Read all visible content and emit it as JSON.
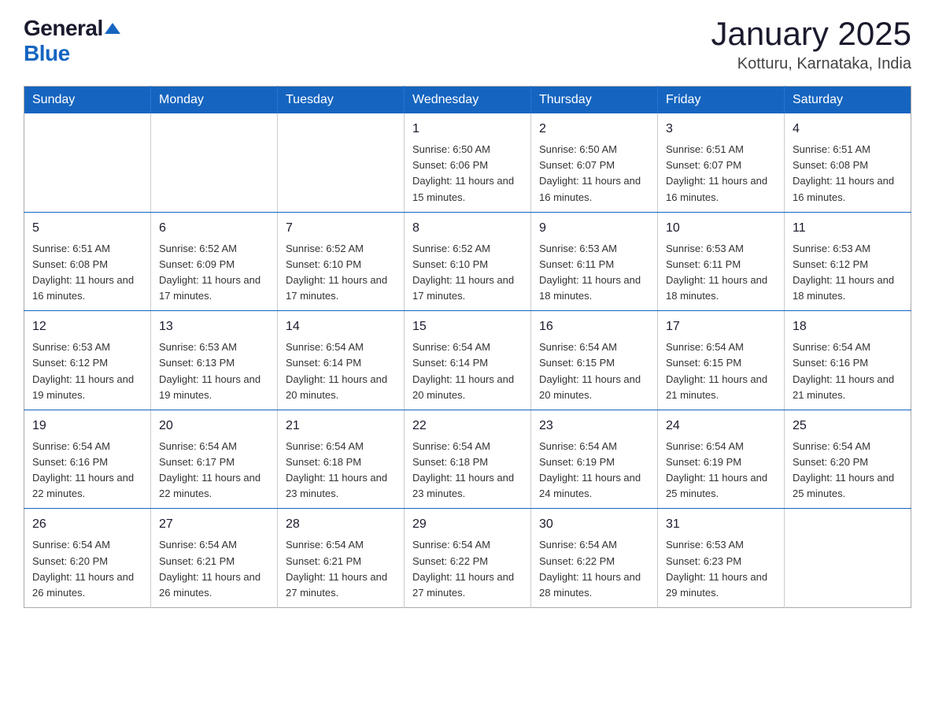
{
  "logo": {
    "general": "General",
    "blue": "Blue"
  },
  "title": "January 2025",
  "location": "Kotturu, Karnataka, India",
  "headers": [
    "Sunday",
    "Monday",
    "Tuesday",
    "Wednesday",
    "Thursday",
    "Friday",
    "Saturday"
  ],
  "weeks": [
    [
      {
        "day": "",
        "info": ""
      },
      {
        "day": "",
        "info": ""
      },
      {
        "day": "",
        "info": ""
      },
      {
        "day": "1",
        "info": "Sunrise: 6:50 AM\nSunset: 6:06 PM\nDaylight: 11 hours and 15 minutes."
      },
      {
        "day": "2",
        "info": "Sunrise: 6:50 AM\nSunset: 6:07 PM\nDaylight: 11 hours and 16 minutes."
      },
      {
        "day": "3",
        "info": "Sunrise: 6:51 AM\nSunset: 6:07 PM\nDaylight: 11 hours and 16 minutes."
      },
      {
        "day": "4",
        "info": "Sunrise: 6:51 AM\nSunset: 6:08 PM\nDaylight: 11 hours and 16 minutes."
      }
    ],
    [
      {
        "day": "5",
        "info": "Sunrise: 6:51 AM\nSunset: 6:08 PM\nDaylight: 11 hours and 16 minutes."
      },
      {
        "day": "6",
        "info": "Sunrise: 6:52 AM\nSunset: 6:09 PM\nDaylight: 11 hours and 17 minutes."
      },
      {
        "day": "7",
        "info": "Sunrise: 6:52 AM\nSunset: 6:10 PM\nDaylight: 11 hours and 17 minutes."
      },
      {
        "day": "8",
        "info": "Sunrise: 6:52 AM\nSunset: 6:10 PM\nDaylight: 11 hours and 17 minutes."
      },
      {
        "day": "9",
        "info": "Sunrise: 6:53 AM\nSunset: 6:11 PM\nDaylight: 11 hours and 18 minutes."
      },
      {
        "day": "10",
        "info": "Sunrise: 6:53 AM\nSunset: 6:11 PM\nDaylight: 11 hours and 18 minutes."
      },
      {
        "day": "11",
        "info": "Sunrise: 6:53 AM\nSunset: 6:12 PM\nDaylight: 11 hours and 18 minutes."
      }
    ],
    [
      {
        "day": "12",
        "info": "Sunrise: 6:53 AM\nSunset: 6:12 PM\nDaylight: 11 hours and 19 minutes."
      },
      {
        "day": "13",
        "info": "Sunrise: 6:53 AM\nSunset: 6:13 PM\nDaylight: 11 hours and 19 minutes."
      },
      {
        "day": "14",
        "info": "Sunrise: 6:54 AM\nSunset: 6:14 PM\nDaylight: 11 hours and 20 minutes."
      },
      {
        "day": "15",
        "info": "Sunrise: 6:54 AM\nSunset: 6:14 PM\nDaylight: 11 hours and 20 minutes."
      },
      {
        "day": "16",
        "info": "Sunrise: 6:54 AM\nSunset: 6:15 PM\nDaylight: 11 hours and 20 minutes."
      },
      {
        "day": "17",
        "info": "Sunrise: 6:54 AM\nSunset: 6:15 PM\nDaylight: 11 hours and 21 minutes."
      },
      {
        "day": "18",
        "info": "Sunrise: 6:54 AM\nSunset: 6:16 PM\nDaylight: 11 hours and 21 minutes."
      }
    ],
    [
      {
        "day": "19",
        "info": "Sunrise: 6:54 AM\nSunset: 6:16 PM\nDaylight: 11 hours and 22 minutes."
      },
      {
        "day": "20",
        "info": "Sunrise: 6:54 AM\nSunset: 6:17 PM\nDaylight: 11 hours and 22 minutes."
      },
      {
        "day": "21",
        "info": "Sunrise: 6:54 AM\nSunset: 6:18 PM\nDaylight: 11 hours and 23 minutes."
      },
      {
        "day": "22",
        "info": "Sunrise: 6:54 AM\nSunset: 6:18 PM\nDaylight: 11 hours and 23 minutes."
      },
      {
        "day": "23",
        "info": "Sunrise: 6:54 AM\nSunset: 6:19 PM\nDaylight: 11 hours and 24 minutes."
      },
      {
        "day": "24",
        "info": "Sunrise: 6:54 AM\nSunset: 6:19 PM\nDaylight: 11 hours and 25 minutes."
      },
      {
        "day": "25",
        "info": "Sunrise: 6:54 AM\nSunset: 6:20 PM\nDaylight: 11 hours and 25 minutes."
      }
    ],
    [
      {
        "day": "26",
        "info": "Sunrise: 6:54 AM\nSunset: 6:20 PM\nDaylight: 11 hours and 26 minutes."
      },
      {
        "day": "27",
        "info": "Sunrise: 6:54 AM\nSunset: 6:21 PM\nDaylight: 11 hours and 26 minutes."
      },
      {
        "day": "28",
        "info": "Sunrise: 6:54 AM\nSunset: 6:21 PM\nDaylight: 11 hours and 27 minutes."
      },
      {
        "day": "29",
        "info": "Sunrise: 6:54 AM\nSunset: 6:22 PM\nDaylight: 11 hours and 27 minutes."
      },
      {
        "day": "30",
        "info": "Sunrise: 6:54 AM\nSunset: 6:22 PM\nDaylight: 11 hours and 28 minutes."
      },
      {
        "day": "31",
        "info": "Sunrise: 6:53 AM\nSunset: 6:23 PM\nDaylight: 11 hours and 29 minutes."
      },
      {
        "day": "",
        "info": ""
      }
    ]
  ]
}
